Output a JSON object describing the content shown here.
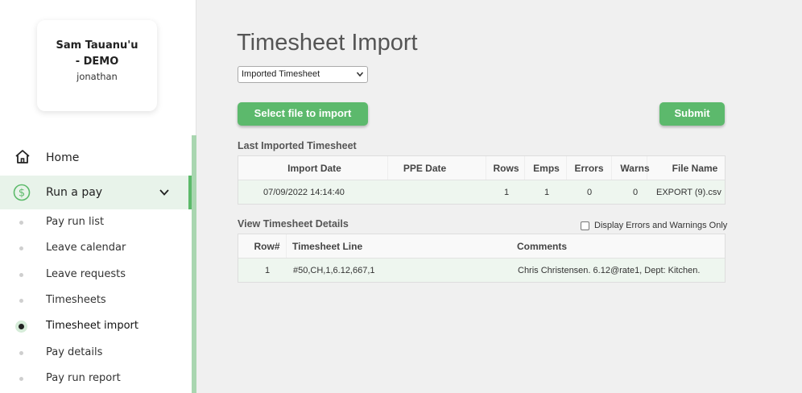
{
  "sidebar": {
    "org_name": "Sam Tauanu'u - DEMO",
    "user": "jonathan",
    "home": {
      "label": "Home",
      "icon": "home-icon"
    },
    "run_a_pay": {
      "label": "Run a pay",
      "icon": "dollar-circle-icon"
    },
    "sub_items": [
      {
        "label": "Pay run list"
      },
      {
        "label": "Leave calendar"
      },
      {
        "label": "Leave requests"
      },
      {
        "label": "Timesheets"
      },
      {
        "label": "Timesheet import"
      },
      {
        "label": "Pay details"
      },
      {
        "label": "Pay run report"
      }
    ],
    "active_index": 4,
    "accent_color": "#5cba6a"
  },
  "main": {
    "title": "Timesheet Import",
    "import_type_select": {
      "value": "Imported Timesheet"
    },
    "select_file_button": "Select file to import",
    "submit_button": "Submit",
    "last_imported": {
      "title": "Last Imported Timesheet",
      "columns": [
        "Import Date",
        "PPE Date",
        "Rows",
        "Emps",
        "Errors",
        "Warns",
        "File Name"
      ],
      "rows": [
        {
          "import_date": "07/09/2022 14:14:40",
          "ppe_date": "",
          "rows": "1",
          "emps": "1",
          "errors": "0",
          "warns": "0",
          "file_name": "EXPORT (9).csv"
        }
      ]
    },
    "details": {
      "title": "View Timesheet Details",
      "errors_only_label": "Display Errors and Warnings Only",
      "errors_only_checked": false,
      "columns": [
        "Row#",
        "Timesheet Line",
        "Comments"
      ],
      "rows": [
        {
          "row": "1",
          "line": "#50,CH,1,6.12,667,1",
          "comments": "Chris Christensen. 6.12@rate1, Dept: Kitchen."
        }
      ]
    },
    "button_color": "#5cb96c"
  }
}
